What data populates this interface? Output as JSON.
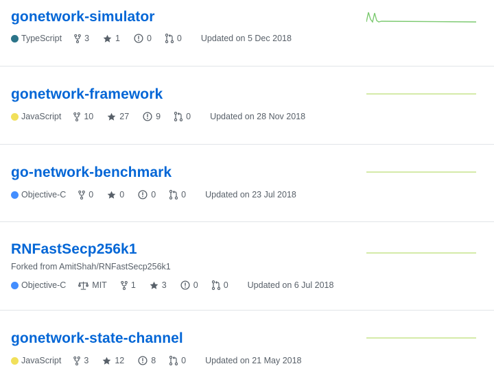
{
  "repos": [
    {
      "name": "gonetwork-simulator",
      "forked_from": "",
      "language": "TypeScript",
      "language_color": "#2b7489",
      "license": "",
      "forks": "3",
      "stars": "1",
      "issues": "0",
      "pulls": "0",
      "updated": "Updated on 5 Dec 2018"
    },
    {
      "name": "gonetwork-framework",
      "forked_from": "",
      "language": "JavaScript",
      "language_color": "#f1e05a",
      "license": "",
      "forks": "10",
      "stars": "27",
      "issues": "9",
      "pulls": "0",
      "updated": "Updated on 28 Nov 2018"
    },
    {
      "name": "go-network-benchmark",
      "forked_from": "",
      "language": "Objective-C",
      "language_color": "#438eff",
      "license": "",
      "forks": "0",
      "stars": "0",
      "issues": "0",
      "pulls": "0",
      "updated": "Updated on 23 Jul 2018"
    },
    {
      "name": "RNFastSecp256k1",
      "forked_from": "Forked from AmitShah/RNFastSecp256k1",
      "language": "Objective-C",
      "language_color": "#438eff",
      "license": "MIT",
      "forks": "1",
      "stars": "3",
      "issues": "0",
      "pulls": "0",
      "updated": "Updated on 6 Jul 2018"
    },
    {
      "name": "gonetwork-state-channel",
      "forked_from": "",
      "language": "JavaScript",
      "language_color": "#f1e05a",
      "license": "",
      "forks": "3",
      "stars": "12",
      "issues": "8",
      "pulls": "0",
      "updated": "Updated on 21 May 2018"
    }
  ],
  "colors": {
    "link": "#0366d6",
    "muted": "#586069",
    "divider": "#e1e4e8",
    "sparkline": "#c6e48b"
  },
  "icons": {
    "forks": "repo-forked-icon",
    "stars": "star-icon",
    "issues": "issue-opened-icon",
    "pulls": "git-pull-request-icon",
    "license": "law-icon"
  }
}
